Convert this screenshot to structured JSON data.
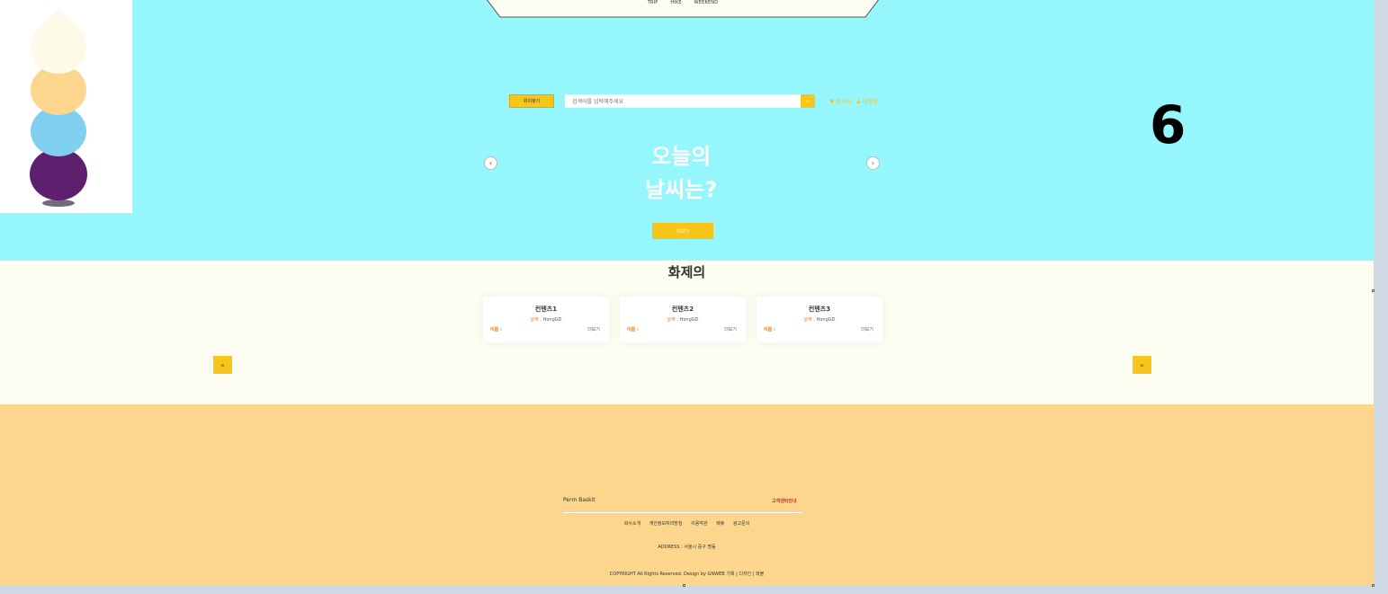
{
  "top_nav": {
    "links": [
      "TRIP",
      "HIKE",
      "WEEKEND"
    ]
  },
  "search": {
    "location_button": "위치찾기",
    "placeholder": "검색어를 입력해주세요",
    "button_icon": "search-icon",
    "status": "♥ 좋아요 · ♟ 내정보"
  },
  "hero": {
    "title_line1": "오늘의",
    "title_line2": "날씨는?",
    "cta": "더보기",
    "prev": "‹",
    "next": "›"
  },
  "overlay_badge": "6",
  "trending": {
    "title": "화제의",
    "cards": [
      {
        "title": "컨텐츠1",
        "sub_label": "날짜",
        "sub_value": " : HongGD",
        "name_label": "이름 :",
        "more": "더보기"
      },
      {
        "title": "컨텐츠2",
        "sub_label": "날짜",
        "sub_value": " : HongGD",
        "name_label": "이름 :",
        "more": "더보기"
      },
      {
        "title": "컨텐츠3",
        "sub_label": "날짜",
        "sub_value": " : HongGD",
        "name_label": "이름 :",
        "more": "더보기"
      }
    ],
    "prev": "«",
    "next": "»"
  },
  "footer": {
    "brand": "Perm Baskit",
    "right_label": "고객센터안내",
    "links": [
      "회사소개",
      "개인정보처리방침",
      "이용약관",
      "제휴",
      "광고문의"
    ],
    "address": "ADDRESS : 서울시 중구 명동",
    "copyright": "COPYRIGHT All Rights Reserved. Design by GNWEB 기획 | 디자인 | 퍼블"
  },
  "colors": {
    "hero_bg": "#95f6fb",
    "accent": "#f8c51a",
    "trending_bg": "#fefdf1",
    "footer_bg": "#fdd68e"
  }
}
